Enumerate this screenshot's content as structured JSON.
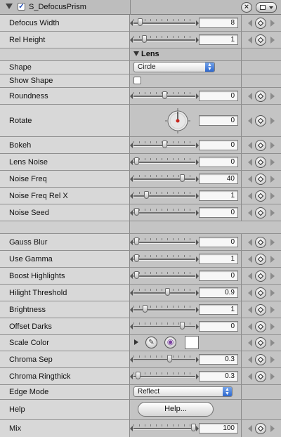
{
  "header": {
    "title": "S_DefocusPrism",
    "enabled": true
  },
  "section_lens": "Lens",
  "params": {
    "defocus_width": {
      "label": "Defocus Width",
      "value": "8",
      "level": 0.1
    },
    "rel_height": {
      "label": "Rel Height",
      "value": "1",
      "level": 0.17
    },
    "shape": {
      "label": "Shape",
      "value": "Circle"
    },
    "show_shape": {
      "label": "Show Shape",
      "checked": false
    },
    "roundness": {
      "label": "Roundness",
      "value": "0",
      "level": 0.5
    },
    "rotate": {
      "label": "Rotate",
      "value": "0"
    },
    "bokeh": {
      "label": "Bokeh",
      "value": "0",
      "level": 0.5
    },
    "lens_noise": {
      "label": "Lens Noise",
      "value": "0",
      "level": 0.05
    },
    "noise_freq": {
      "label": "Noise Freq",
      "value": "40",
      "level": 0.78
    },
    "noise_freq_rel_x": {
      "label": "Noise Freq Rel X",
      "value": "1",
      "level": 0.2
    },
    "noise_seed": {
      "label": "Noise Seed",
      "value": "0",
      "level": 0.05
    },
    "gauss_blur": {
      "label": "Gauss Blur",
      "value": "0",
      "level": 0.05
    },
    "use_gamma": {
      "label": "Use Gamma",
      "value": "1",
      "level": 0.05
    },
    "boost_highlights": {
      "label": "Boost Highlights",
      "value": "0",
      "level": 0.05
    },
    "hilight_threshold": {
      "label": "Hilight Threshold",
      "value": "0.9",
      "level": 0.55
    },
    "brightness": {
      "label": "Brightness",
      "value": "1",
      "level": 0.18
    },
    "offset_darks": {
      "label": "Offset Darks",
      "value": "0",
      "level": 0.78
    },
    "scale_color": {
      "label": "Scale Color",
      "swatch": "#ffffff"
    },
    "chroma_sep": {
      "label": "Chroma Sep",
      "value": "0.3",
      "level": 0.58
    },
    "chroma_ringthick": {
      "label": "Chroma Ringthick",
      "value": "0.3",
      "level": 0.07
    },
    "edge_mode": {
      "label": "Edge Mode",
      "value": "Reflect"
    },
    "help": {
      "label": "Help",
      "button": "Help..."
    },
    "mix": {
      "label": "Mix",
      "value": "100",
      "level": 0.97
    }
  }
}
